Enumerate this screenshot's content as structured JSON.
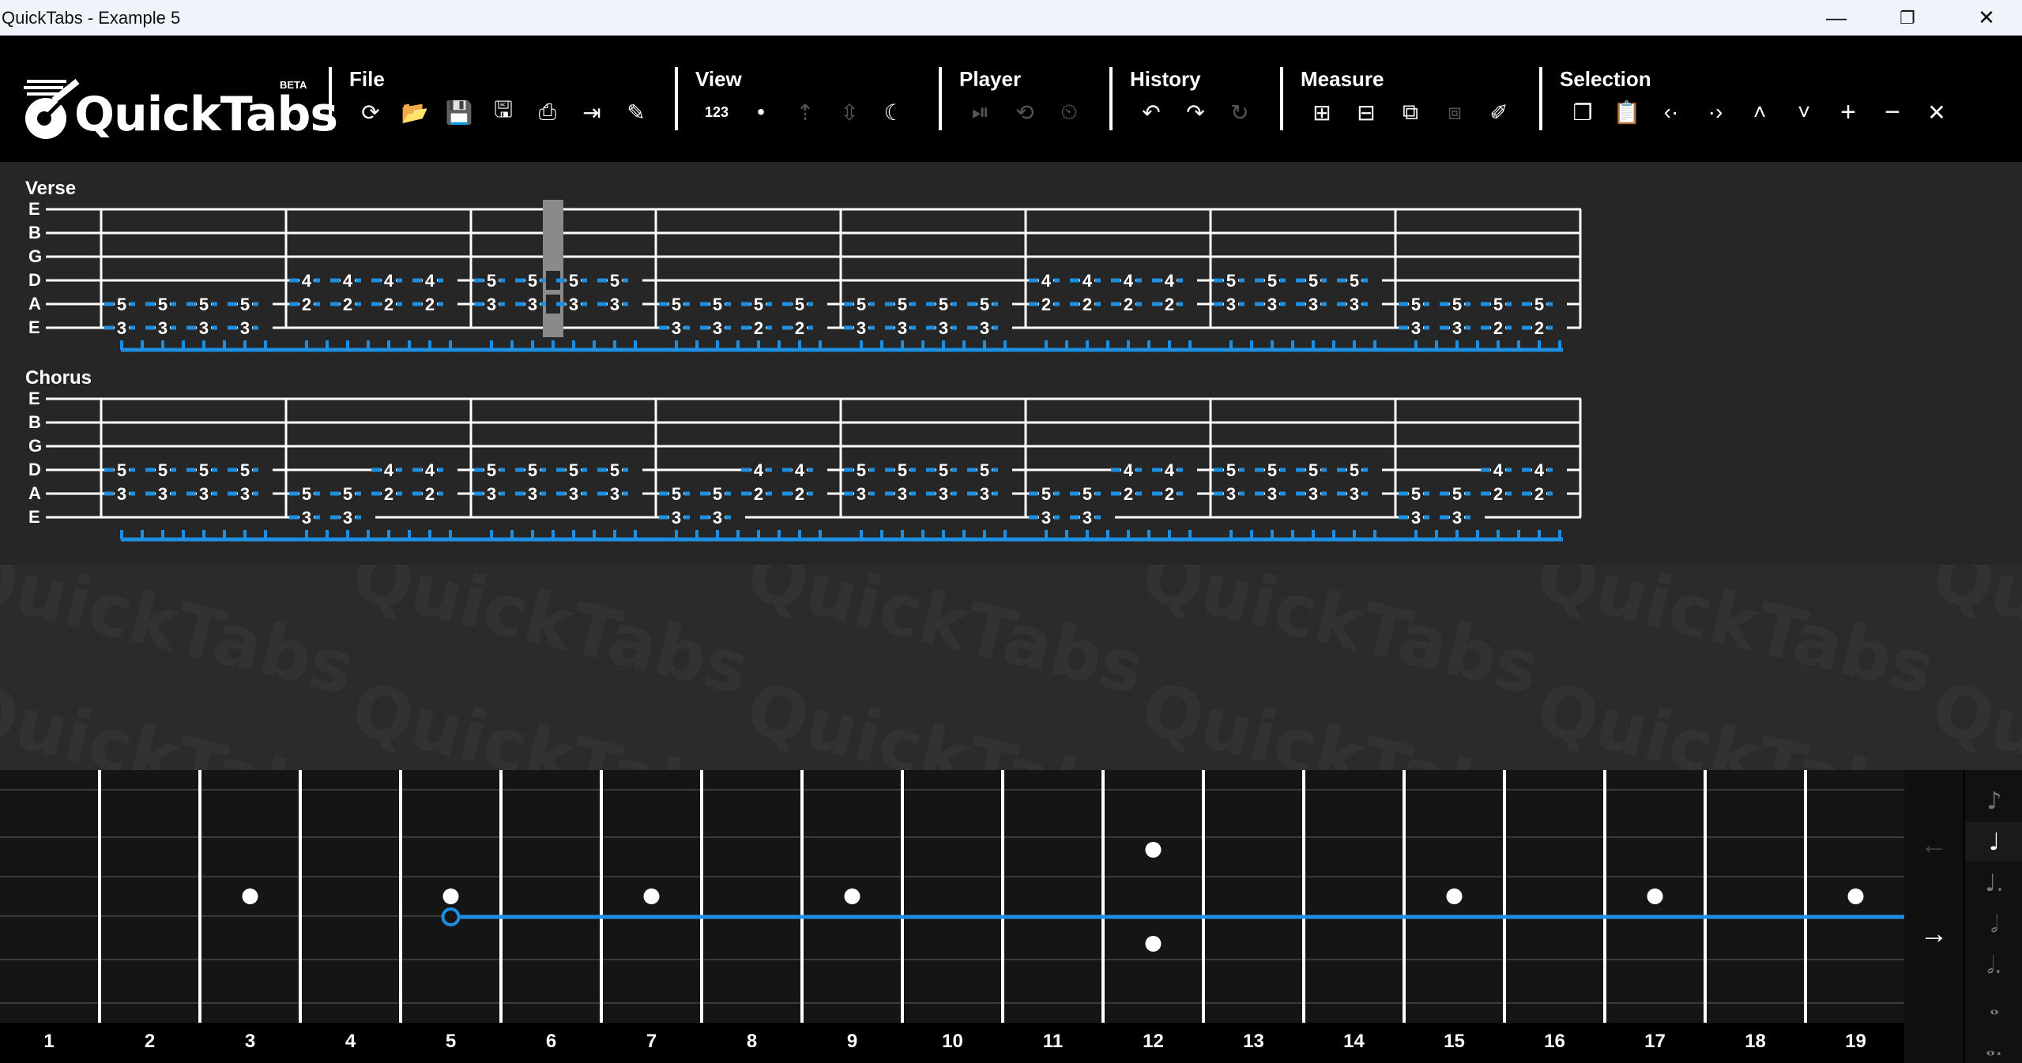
{
  "window": {
    "title": "QuickTabs - Example 5",
    "min_icon": "minimize-icon",
    "max_icon": "restore-icon",
    "close_icon": "close-icon"
  },
  "brand": {
    "name": "QuickTabs",
    "badge": "BETA"
  },
  "toolbar": {
    "groups": [
      {
        "label": "File",
        "buttons": [
          "new-icon",
          "open-icon",
          "save-icon",
          "save-as-icon",
          "print-icon",
          "export-icon",
          "edit-pencil-icon"
        ]
      },
      {
        "label": "View",
        "buttons": [
          "numbers-icon",
          "dot-icon",
          "scroll-up-icon",
          "fit-height-icon",
          "dark-mode-icon"
        ]
      },
      {
        "label": "Player",
        "buttons": [
          "play-pause-icon",
          "loop-icon",
          "metronome-icon"
        ]
      },
      {
        "label": "History",
        "buttons": [
          "undo-icon",
          "redo-icon",
          "repeat-icon"
        ]
      },
      {
        "label": "Measure",
        "buttons": [
          "add-measure-icon",
          "remove-measure-icon",
          "add-after-icon",
          "remove-after-icon",
          "edit-measure-icon"
        ]
      },
      {
        "label": "Selection",
        "buttons": [
          "copy-icon",
          "paste-icon",
          "shift-left-icon",
          "shift-right-icon",
          "shift-up-icon",
          "shift-down-icon",
          "plus-icon",
          "minus-icon",
          "clear-icon"
        ]
      }
    ],
    "view_numbers": "123"
  },
  "strings": [
    "E",
    "B",
    "G",
    "D",
    "A",
    "E"
  ],
  "sections": [
    {
      "name": "Verse",
      "measures": [
        {
          "A": [
            "5",
            "5",
            "5",
            "5"
          ],
          "E": [
            "3",
            "3",
            "3",
            "3"
          ]
        },
        {
          "D": [
            "4",
            "4",
            "4",
            "4"
          ],
          "A": [
            "2",
            "2",
            "2",
            "2"
          ]
        },
        {
          "D": [
            "5",
            "5",
            "5",
            "5"
          ],
          "A": [
            "3",
            "3",
            "3",
            "3"
          ]
        },
        {
          "A": [
            "5",
            "5",
            "5",
            "5"
          ],
          "E": [
            "3",
            "3",
            "2",
            "2"
          ]
        },
        {
          "A": [
            "5",
            "5",
            "5",
            "5"
          ],
          "E": [
            "3",
            "3",
            "3",
            "3"
          ]
        },
        {
          "D": [
            "4",
            "4",
            "4",
            "4"
          ],
          "A": [
            "2",
            "2",
            "2",
            "2"
          ]
        },
        {
          "D": [
            "5",
            "5",
            "5",
            "5"
          ],
          "A": [
            "3",
            "3",
            "3",
            "3"
          ]
        },
        {
          "A": [
            "5",
            "5",
            "5",
            "5"
          ],
          "E": [
            "3",
            "3",
            "2",
            "2"
          ]
        }
      ]
    },
    {
      "name": "Chorus",
      "measures": [
        {
          "D": [
            "5",
            "5",
            "5",
            "5"
          ],
          "A": [
            "3",
            "3",
            "3",
            "3"
          ]
        },
        {
          "D": [
            "",
            "",
            "4",
            "4"
          ],
          "A": [
            "5",
            "5",
            "2",
            "2"
          ],
          "E": [
            "3",
            "3",
            "",
            ""
          ]
        },
        {
          "D": [
            "5",
            "5",
            "5",
            "5"
          ],
          "A": [
            "3",
            "3",
            "3",
            "3"
          ]
        },
        {
          "D": [
            "",
            "",
            "4",
            "4"
          ],
          "A": [
            "5",
            "5",
            "2",
            "2"
          ],
          "E": [
            "3",
            "3",
            "",
            ""
          ]
        },
        {
          "D": [
            "5",
            "5",
            "5",
            "5"
          ],
          "A": [
            "3",
            "3",
            "3",
            "3"
          ]
        },
        {
          "D": [
            "",
            "",
            "4",
            "4"
          ],
          "A": [
            "5",
            "5",
            "2",
            "2"
          ],
          "E": [
            "3",
            "3",
            "",
            ""
          ]
        },
        {
          "D": [
            "5",
            "5",
            "5",
            "5"
          ],
          "A": [
            "3",
            "3",
            "3",
            "3"
          ]
        },
        {
          "D": [
            "",
            "",
            "4",
            "4"
          ],
          "A": [
            "5",
            "5",
            "2",
            "2"
          ],
          "E": [
            "3",
            "3",
            "",
            ""
          ]
        }
      ]
    }
  ],
  "cursor": {
    "section": 0,
    "measure": 2,
    "beat": 1
  },
  "watermark": "QuickTabs",
  "fretboard": {
    "fret_numbers": [
      "1",
      "2",
      "3",
      "4",
      "5",
      "6",
      "7",
      "8",
      "9",
      "10",
      "11",
      "12",
      "13",
      "14",
      "15",
      "16",
      "17",
      "18",
      "19"
    ],
    "single_dots": [
      3,
      5,
      7,
      9,
      15,
      17,
      19
    ],
    "double_dots": [
      12
    ],
    "selected": {
      "string": "A",
      "fret": 5
    },
    "accent": "#1e8fe0"
  },
  "nav": {
    "back_icon": "arrow-left-icon",
    "forward_icon": "arrow-right-icon"
  },
  "durations": [
    {
      "name": "eighth-note-icon",
      "glyph": "♪"
    },
    {
      "name": "quarter-note-icon",
      "glyph": "♩"
    },
    {
      "name": "dotted-quarter-note-icon",
      "glyph": "♩."
    },
    {
      "name": "half-note-icon",
      "glyph": "𝅗𝅥"
    },
    {
      "name": "dotted-half-note-icon",
      "glyph": "𝅗𝅥."
    },
    {
      "name": "whole-note-icon",
      "glyph": "𝅝"
    },
    {
      "name": "dotted-whole-note-icon",
      "glyph": "𝅝."
    }
  ],
  "active_duration": 1
}
